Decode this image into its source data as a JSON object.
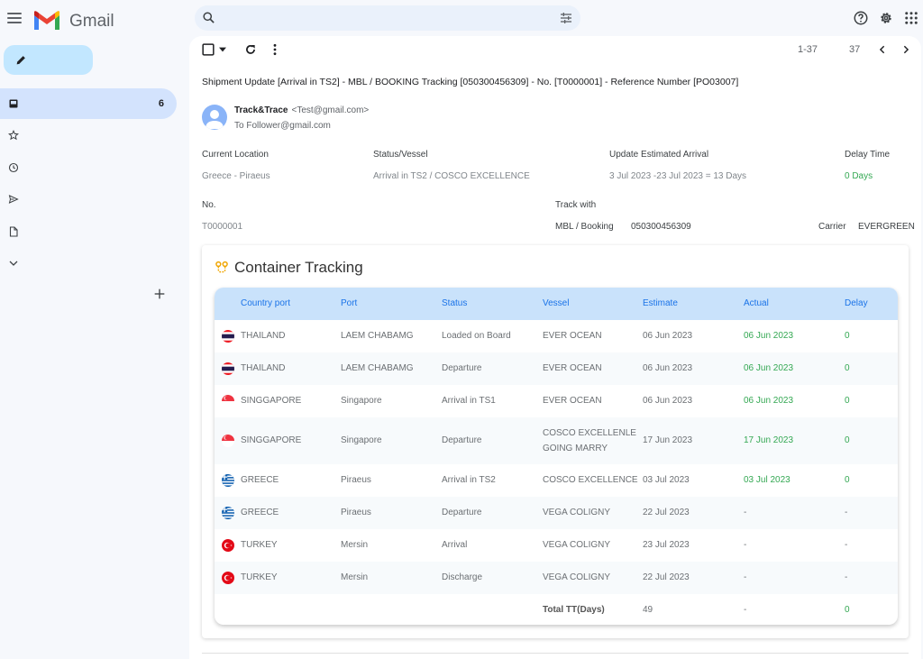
{
  "app": {
    "brand": "Gmail"
  },
  "search": {
    "placeholder": "",
    "value": ""
  },
  "sidebar": {
    "inbox_count": "6"
  },
  "toolbar": {
    "pager_range": "1-37",
    "pager_total": "37"
  },
  "email": {
    "subject": "Shipment Update [Arrival in TS2] - MBL / BOOKING Tracking [050300456309] - No. [T0000001] - Reference Number [PO03007]",
    "sender_name": "Track&Trace",
    "sender_email": "<Test@gmail.com>",
    "to_line": "To Follower@gmail.com"
  },
  "info": {
    "current_location_label": "Current Location",
    "current_location_value": "Greece - Piraeus",
    "status_label": "Status/Vessel",
    "status_value": "Arrival in TS2 / COSCO EXCELLENCE",
    "eta_label": "Update Estimated Arrival",
    "eta_value": "3 Jul 2023 -23 Jul 2023 = 13 Days",
    "delay_label": "Delay Time",
    "delay_value": "0 Days",
    "no_label": "No.",
    "no_value": "T0000001",
    "track_label": "Track with",
    "track_type": "MBL / Booking",
    "track_number": "050300456309",
    "carrier_label": "Carrier",
    "carrier_value": "EVERGREEN"
  },
  "tracking": {
    "title": "Container Tracking",
    "headers": [
      "Country port",
      "Port",
      "Status",
      "Vessel",
      "Estimate",
      "Actual",
      "Delay"
    ],
    "rows": [
      {
        "flag": "thailand-flag",
        "country": "THAILAND",
        "port": "LAEM CHABAMG",
        "status": "Loaded on Board",
        "vessel": "EVER OCEAN",
        "vessel2": "",
        "estimate": "06 Jun 2023",
        "actual": "06 Jun 2023",
        "delay": "0"
      },
      {
        "flag": "thailand-flag",
        "country": "THAILAND",
        "port": "LAEM CHABAMG",
        "status": "Departure",
        "vessel": "EVER OCEAN",
        "vessel2": "",
        "estimate": "06 Jun 2023",
        "actual": "06 Jun 2023",
        "delay": "0"
      },
      {
        "flag": "singapore-flag",
        "country": "SINGGAPORE",
        "port": "Singapore",
        "status": "Arrival in TS1",
        "vessel": "EVER OCEAN",
        "vessel2": "",
        "estimate": "06 Jun 2023",
        "actual": "06 Jun 2023",
        "delay": "0"
      },
      {
        "flag": "singapore-flag",
        "country": "SINGGAPORE",
        "port": "Singapore",
        "status": "Departure",
        "vessel": "COSCO EXCELLENLE",
        "vessel2": "GOING MARRY",
        "estimate": "17 Jun 2023",
        "actual": "17 Jun 2023",
        "delay": "0"
      },
      {
        "flag": "greece-flag",
        "country": "GREECE",
        "port": "Piraeus",
        "status": "Arrival in TS2",
        "vessel": "COSCO EXCELLENCE",
        "vessel2": "",
        "estimate": "03 Jul 2023",
        "actual": "03 Jul 2023",
        "delay": "0"
      },
      {
        "flag": "greece-flag",
        "country": "GREECE",
        "port": "Piraeus",
        "status": "Departure",
        "vessel": "VEGA COLIGNY",
        "vessel2": "",
        "estimate": "22 Jul 2023",
        "actual": "-",
        "delay": "-"
      },
      {
        "flag": "turkey-flag",
        "country": "TURKEY",
        "port": "Mersin",
        "status": "Arrival",
        "vessel": "VEGA COLIGNY",
        "vessel2": "",
        "estimate": "23 Jul 2023",
        "actual": "-",
        "delay": "-"
      },
      {
        "flag": "turkey-flag",
        "country": "TURKEY",
        "port": "Mersin",
        "status": "Discharge",
        "vessel": "VEGA COLIGNY",
        "vessel2": "",
        "estimate": "22 Jul 2023",
        "actual": "-",
        "delay": "-"
      }
    ],
    "total": {
      "label": "Total TT(Days)",
      "estimate": "49",
      "actual": "-",
      "delay": "0"
    }
  },
  "colors": {
    "accent": "#1a73e8",
    "green": "#34a853",
    "header_bg": "#c9e2fb",
    "active_nav": "#d3e3fd",
    "compose": "#c2e7ff"
  }
}
